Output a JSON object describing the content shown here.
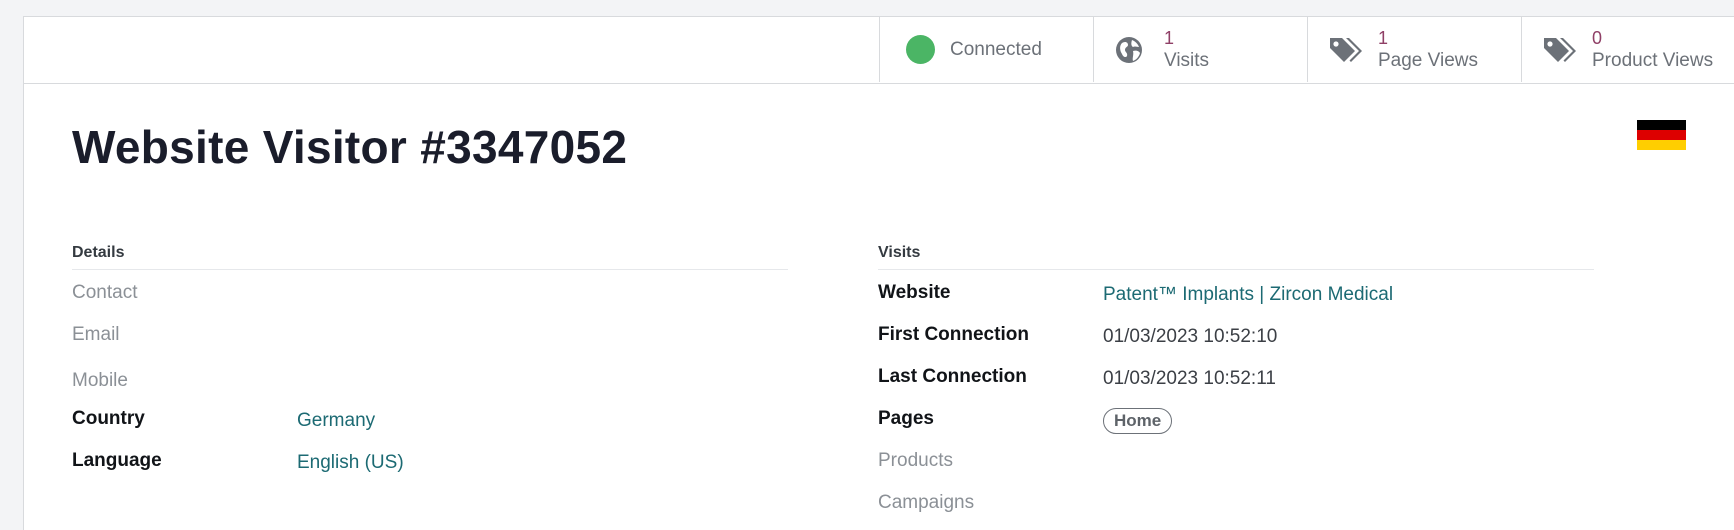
{
  "stats": {
    "connected_label": "Connected",
    "visits": {
      "value": "1",
      "label": "Visits",
      "icon": "globe-icon"
    },
    "page_views": {
      "value": "1",
      "label": "Page Views",
      "icon": "tags-icon"
    },
    "product_views": {
      "value": "0",
      "label": "Product Views",
      "icon": "tags-icon"
    },
    "connected_color": "#4bb565"
  },
  "header": {
    "title": "Website Visitor #3347052"
  },
  "flag": {
    "country": "Germany",
    "colors": [
      "#000000",
      "#dd0000",
      "#ffce00"
    ]
  },
  "details": {
    "title": "Details",
    "contact_label": "Contact",
    "email_label": "Email",
    "mobile_label": "Mobile",
    "country_label": "Country",
    "country_value": "Germany",
    "language_label": "Language",
    "language_value": "English (US)"
  },
  "visits": {
    "title": "Visits",
    "website_label": "Website",
    "website_value": "Patent™ Implants | Zircon Medical",
    "first_connection_label": "First Connection",
    "first_connection_value": "01/03/2023 10:52:10",
    "last_connection_label": "Last Connection",
    "last_connection_value": "01/03/2023 10:52:11",
    "pages_label": "Pages",
    "pages_tags": [
      "Home"
    ],
    "products_label": "Products",
    "campaigns_label": "Campaigns"
  },
  "colors": {
    "link": "#1c6a73",
    "stat_number": "#8f3f66"
  }
}
